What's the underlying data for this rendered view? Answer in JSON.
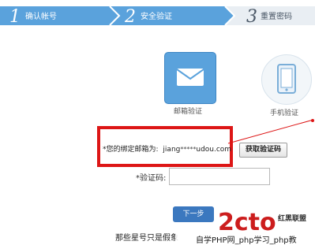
{
  "steps": [
    {
      "num": "1",
      "label": "确认帐号"
    },
    {
      "num": "2",
      "label": "安全验证"
    },
    {
      "num": "3",
      "label": "重置密码"
    }
  ],
  "methods": {
    "email_label": "邮箱验证",
    "phone_label": "手机验证"
  },
  "bound_email": {
    "label": "*您的绑定邮箱为:",
    "value_start": "jiang",
    "value_mask": "*****",
    "value_end": "udou.com"
  },
  "buttons": {
    "get_code": "获取验证码",
    "next": "下一步"
  },
  "verify_label": "*验证码:",
  "caption": "那些星号只是假象",
  "watermark": {
    "logo": "2cto",
    "brand": "红黑联盟",
    "line": "自学PHP网_php学习_php教"
  },
  "colors": {
    "steps_bar": "#5aa2dc",
    "current_step": "#e9eef3",
    "highlight": "#dd1616",
    "primary": "#3b78bf"
  }
}
